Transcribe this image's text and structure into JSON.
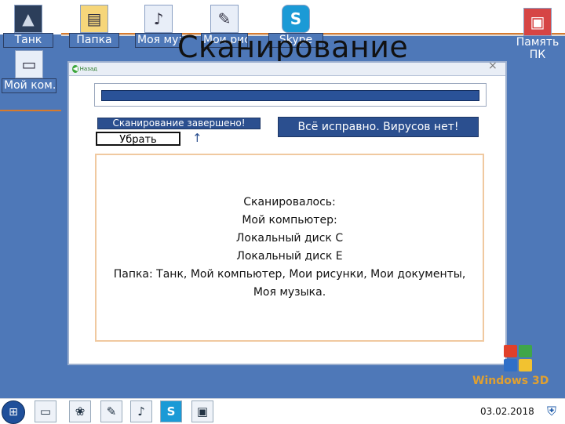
{
  "title": "Сканирование",
  "desktop": {
    "icons": [
      {
        "label": "Танк",
        "glyph": "▲"
      },
      {
        "label": "Папка",
        "glyph": "📁"
      },
      {
        "label": "Моя муз…",
        "glyph": "♪"
      },
      {
        "label": "Мои рис…",
        "glyph": "✎"
      },
      {
        "label": "Skype",
        "glyph": "S"
      },
      {
        "label": "Мой ком…",
        "glyph": "▭"
      },
      {
        "label": "Память ПК",
        "glyph": "💾"
      }
    ]
  },
  "scan_window": {
    "back_label": "Назад",
    "close_glyph": "×",
    "progress": 1.0,
    "status_text": "Сканирование завершено!",
    "remove_button": "Убрать",
    "result_badge": "Всё исправно. Вирусов нет!",
    "results": [
      "Сканировалось:",
      "Мой компьютер:",
      "Локальный диск С",
      "Локальный диск Е",
      "Папка: Танк, Мой компьютер, Мои рисунки, Мои документы,",
      "Моя музыка."
    ]
  },
  "branding": {
    "logo_text": "Windows 3D",
    "colors": {
      "red": "#e0402a",
      "green": "#3fa64a",
      "blue": "#2f6fc8",
      "yellow": "#f2c230"
    }
  },
  "taskbar": {
    "start_icon": "windows-logo",
    "icons": [
      "computer",
      "pictures",
      "documents",
      "music",
      "skype",
      "monitor"
    ],
    "clock": "03.02.2018",
    "tray_icon": "shield"
  },
  "colors": {
    "desktop_blue": "#4e78b8",
    "status_blue": "#2b4f8f"
  }
}
